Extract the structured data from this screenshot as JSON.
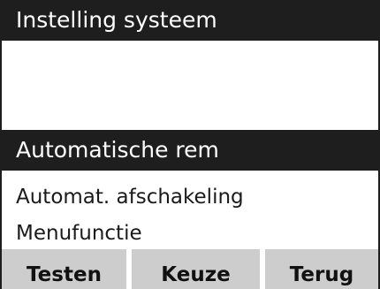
{
  "header": {
    "title": "Instelling systeem"
  },
  "section": {
    "title": "Automatische rem"
  },
  "menu": {
    "items": [
      {
        "label": "Automat. afschakeling"
      },
      {
        "label": "Menufunctie"
      }
    ]
  },
  "softkeys": {
    "left": "Testen",
    "middle": "Keuze",
    "right": "Terug"
  },
  "colors": {
    "bar_background": "#1e1e1e",
    "bar_text": "#ffffff",
    "softkey_background": "#cdcdcd",
    "screen_background": "#ffffff"
  }
}
